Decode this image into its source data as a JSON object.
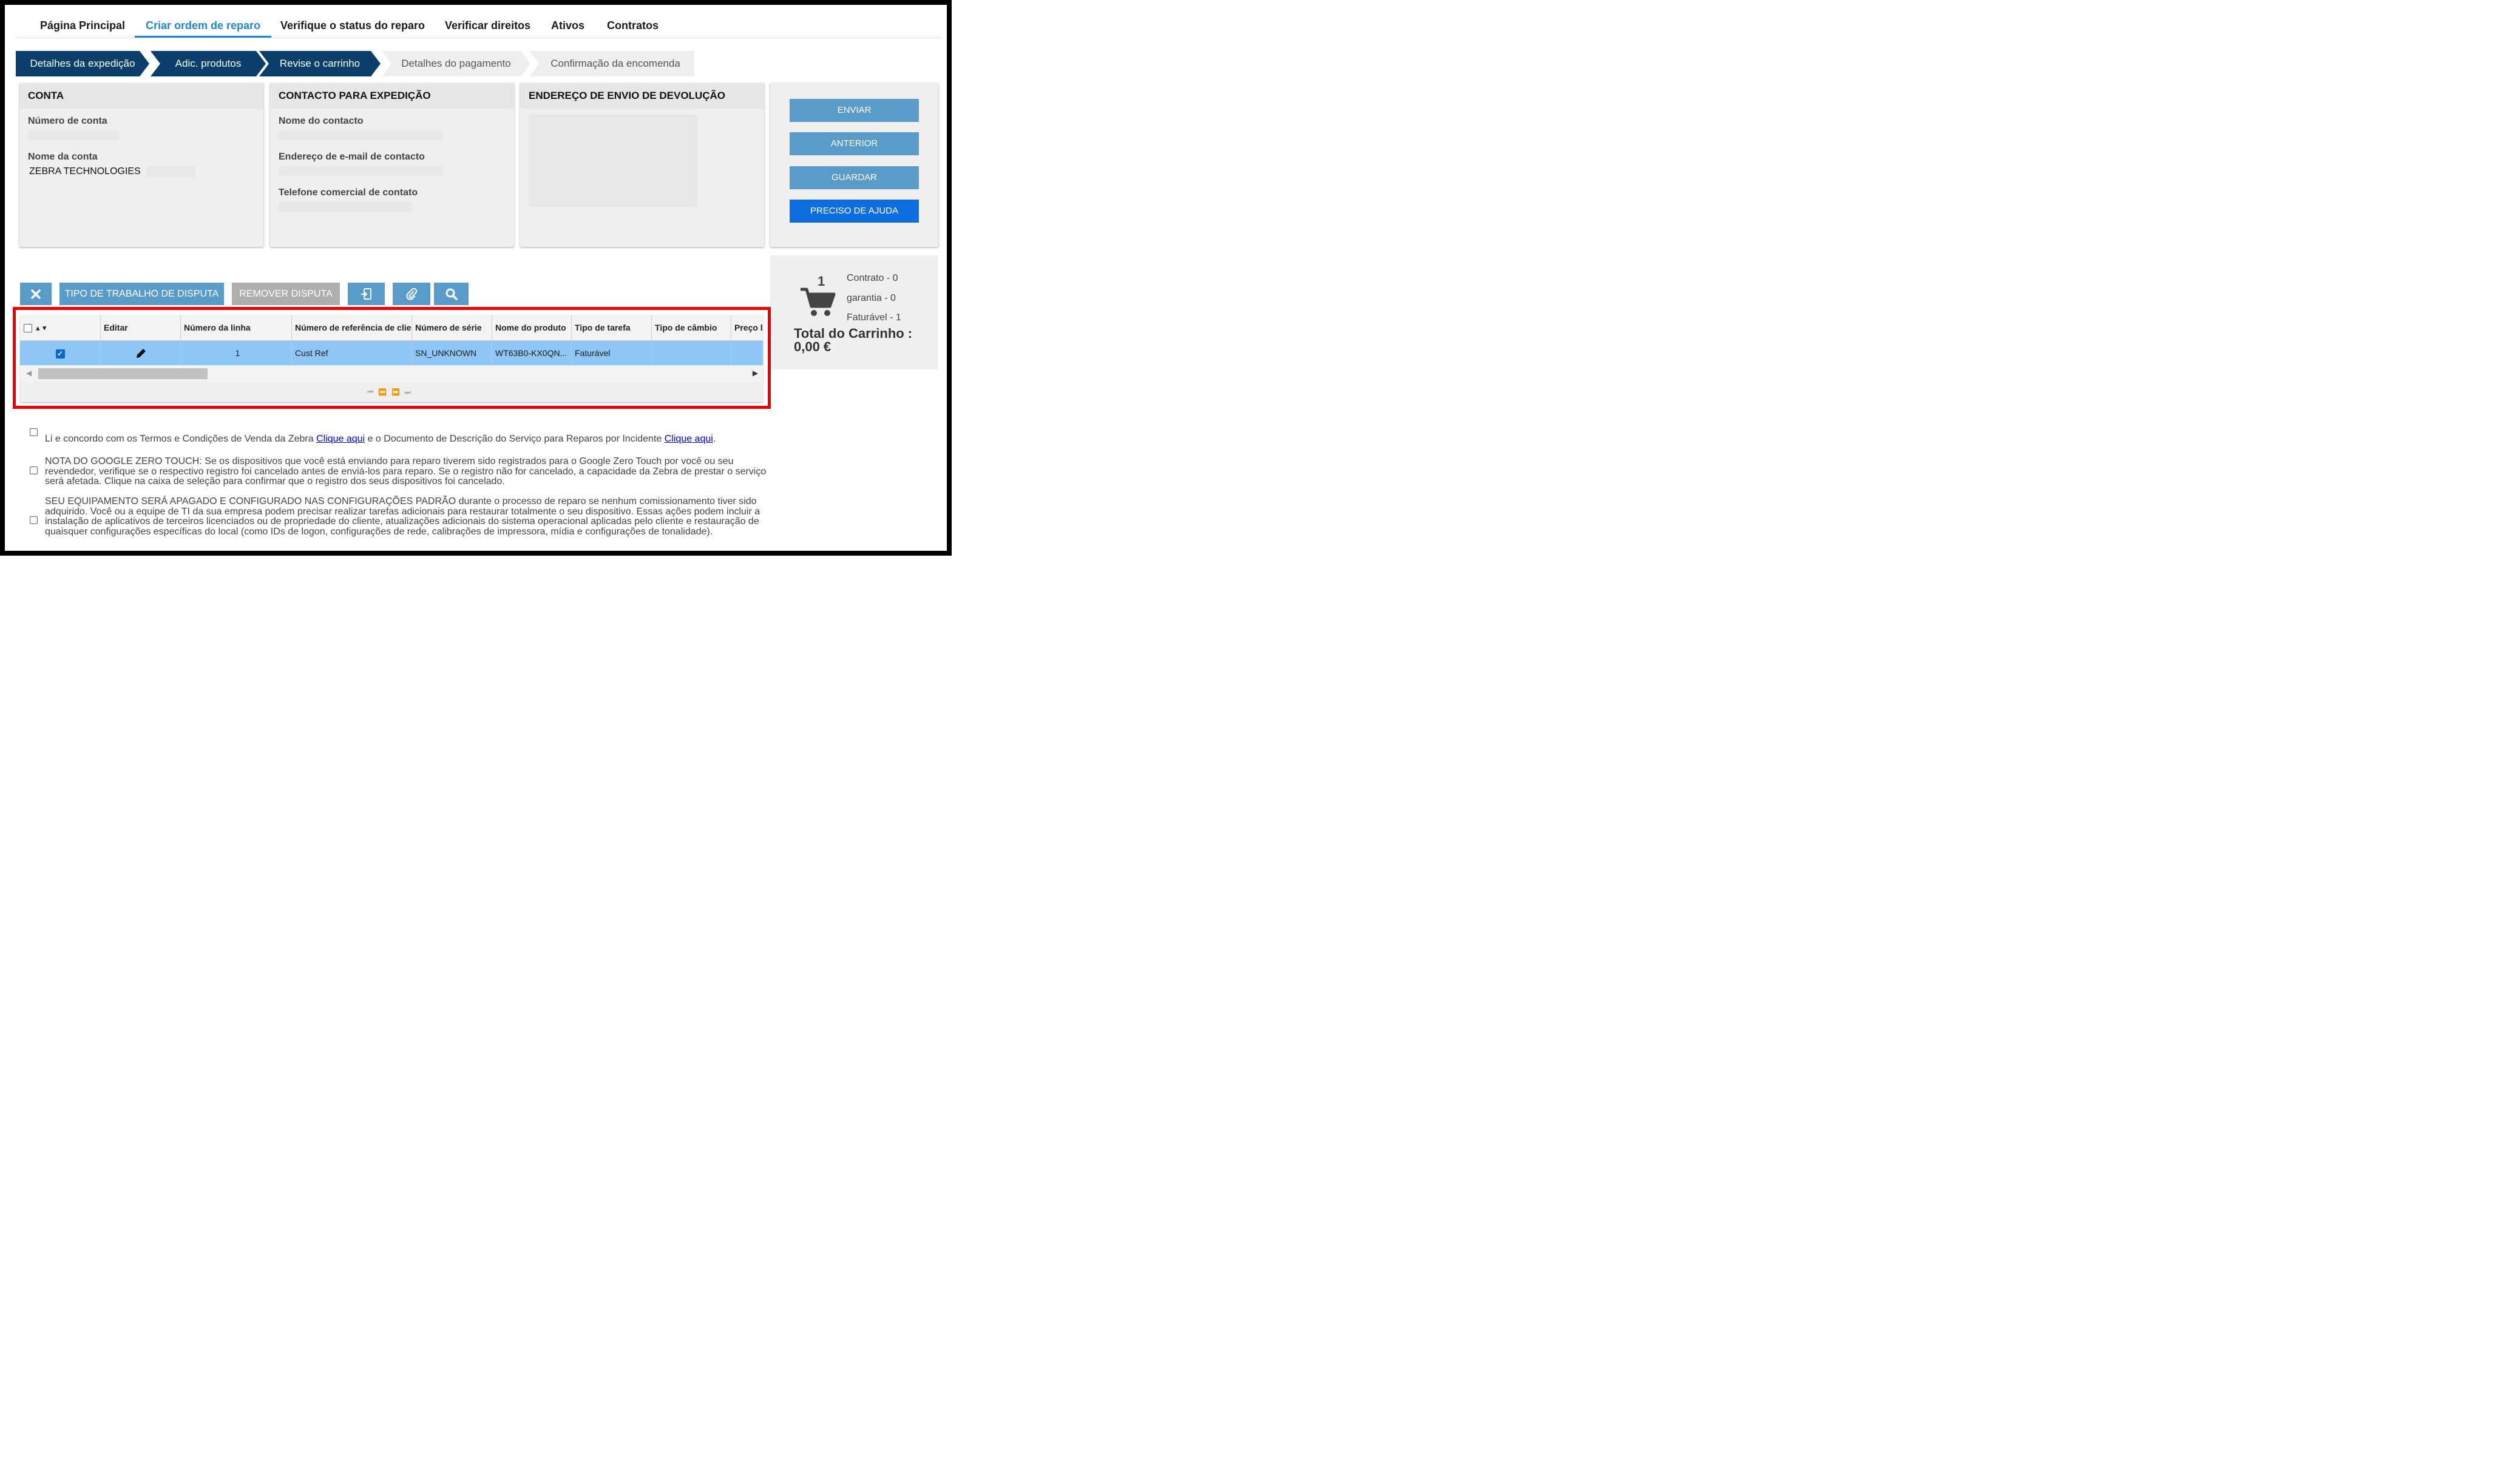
{
  "nav": {
    "tabs": [
      "Página Principal",
      "Criar ordem de reparo",
      "Verifique o status do reparo",
      "Verificar direitos",
      "Ativos",
      "Contratos"
    ],
    "active": "Criar ordem de reparo"
  },
  "steps": [
    "Detalhes da expedição",
    "Adic. produtos",
    "Revise o carrinho",
    "Detalhes do pagamento",
    "Confirmação da encomenda"
  ],
  "account": {
    "title": "CONTA",
    "number_label": "Número de conta",
    "name_label": "Nome da conta",
    "name_value": "ZEBRA TECHNOLOGIES"
  },
  "contact": {
    "title": "CONTACTO PARA EXPEDIÇÃO",
    "name_label": "Nome do contacto",
    "email_label": "Endereço de e-mail de contacto",
    "phone_label": "Telefone comercial de contato"
  },
  "return_address": {
    "title": "ENDEREÇO DE ENVIO DE DEVOLUÇÃO"
  },
  "actions": {
    "send": "ENVIAR",
    "previous": "ANTERIOR",
    "save": "GUARDAR",
    "help": "PRECISO DE AJUDA"
  },
  "cart": {
    "count": "1",
    "contract": "Contrato - 0",
    "warranty": "garantia - 0",
    "billable": "Faturável - 1",
    "total_label": "Total do Carrinho :",
    "total_value": "0,00 €"
  },
  "toolbar": {
    "dispute_type": "TIPO DE TRABALHO DE DISPUTA",
    "remove_dispute": "REMOVER DISPUTA"
  },
  "grid": {
    "headers": [
      "Editar",
      "Número da linha",
      "Número de referência de cliente",
      "Número de série",
      "Nome do produto",
      "Tipo de tarefa",
      "Tipo de câmbio",
      "Preço l"
    ],
    "row": {
      "selected": true,
      "line": "1",
      "ref": "Cust Ref",
      "serial": "SN_UNKNOWN",
      "product": "WT63B0-KX0QN...",
      "task": "Faturável",
      "exchange": "",
      "price": ""
    }
  },
  "terms": {
    "t1_a": "Li e concordo com os Termos e Condições de Venda da Zebra ",
    "t1_link1": "Clique aqui",
    "t1_b": " e o Documento de Descrição do Serviço para Reparos por Incidente ",
    "t1_link2": "Clique aqui",
    "t1_c": ".",
    "t2": "NOTA DO GOOGLE ZERO TOUCH: Se os dispositivos que você está enviando para reparo tiverem sido registrados para o Google Zero Touch por você ou seu revendedor, verifique se o respectivo registro foi cancelado antes de enviá-los para reparo. Se o registro não for cancelado, a capacidade da Zebra de prestar o serviço será afetada. Clique na caixa de seleção para confirmar que o registro dos seus dispositivos foi cancelado.",
    "t3": "SEU EQUIPAMENTO SERÁ APAGADO E CONFIGURADO NAS CONFIGURAÇÕES PADRÃO durante o processo de reparo se nenhum comissionamento tiver sido adquirido. Você ou a equipe de TI da sua empresa podem precisar realizar tarefas adicionais para restaurar totalmente o seu dispositivo. Essas ações podem incluir a instalação de aplicativos de terceiros licenciados ou de propriedade do cliente, atualizações adicionais do sistema operacional aplicadas pelo cliente e restauração de quaisquer configurações específicas do local (como IDs de logon, configurações de rede, calibrações de impressora, mídia e configurações de tonalidade)."
  },
  "colors": {
    "accent": "#1e88d2",
    "step_done": "#0b3f6b",
    "button": "#5a9cc9",
    "help_button": "#0d6ee0",
    "selected_row": "#8ec6f5",
    "highlight_border": "#ee0000"
  },
  "icons": [
    "close-icon",
    "import-icon",
    "paperclip-icon",
    "search-icon",
    "pencil-icon",
    "cart-icon",
    "sort-icon"
  ]
}
